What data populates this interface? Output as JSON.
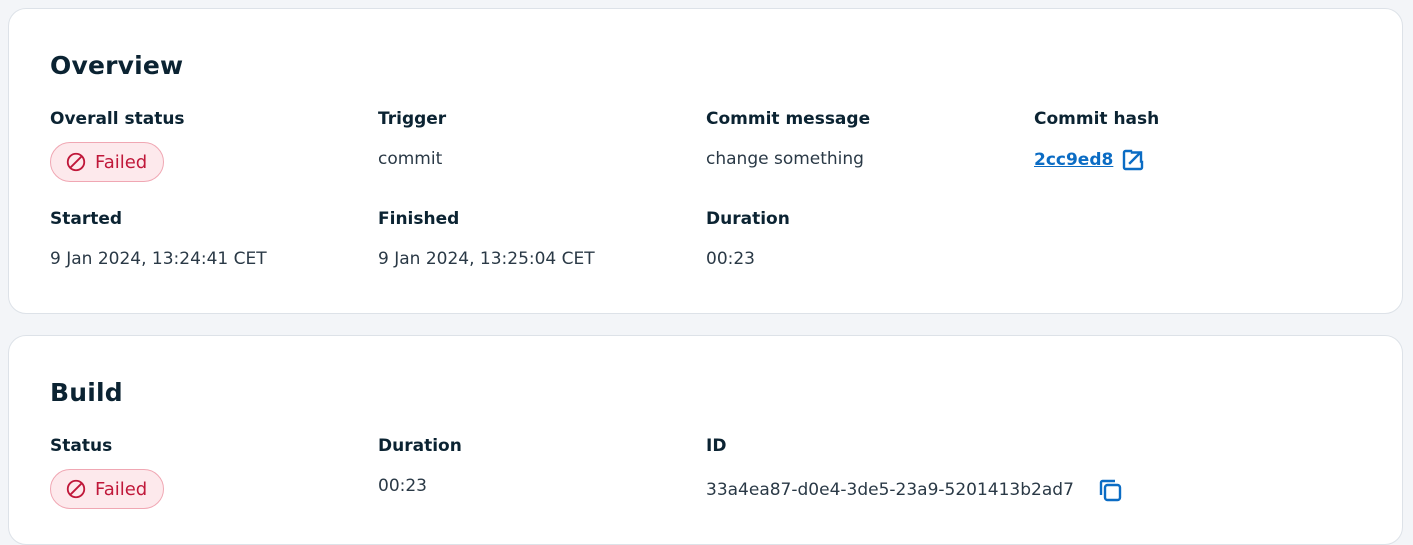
{
  "overview": {
    "title": "Overview",
    "overall_status": {
      "label": "Overall status",
      "value": "Failed"
    },
    "trigger": {
      "label": "Trigger",
      "value": "commit"
    },
    "commit_message": {
      "label": "Commit message",
      "value": "change something"
    },
    "commit_hash": {
      "label": "Commit hash",
      "value": "2cc9ed8",
      "icon": "external-link-icon"
    },
    "started": {
      "label": "Started",
      "value": "9 Jan 2024, 13:24:41 CET"
    },
    "finished": {
      "label": "Finished",
      "value": "9 Jan 2024, 13:25:04 CET"
    },
    "duration": {
      "label": "Duration",
      "value": "00:23"
    }
  },
  "build": {
    "title": "Build",
    "status": {
      "label": "Status",
      "value": "Failed"
    },
    "duration": {
      "label": "Duration",
      "value": "00:23"
    },
    "id": {
      "label": "ID",
      "value": "33a4ea87-d0e4-3de5-23a9-5201413b2ad7",
      "icon": "copy-icon"
    }
  },
  "colors": {
    "failed_text": "#c0183a",
    "failed_bg": "#fde9ec",
    "failed_border": "#f0a7b3",
    "link": "#0b6cc4",
    "heading": "#0b2332"
  }
}
